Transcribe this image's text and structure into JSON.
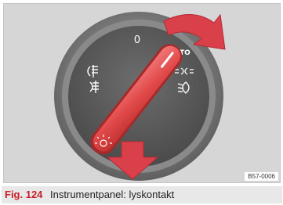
{
  "figure": {
    "label": "Fig. 124",
    "caption": "Instrumentpanel: lyskontakt",
    "image_code": "B57-0006"
  },
  "switch": {
    "pos_off": "0",
    "pos_auto": "AUTO",
    "icon_fog_front": "front-fog-light-icon",
    "icon_fog_rear": "rear-fog-light-icon",
    "icon_parking": "parking-light-icon",
    "icon_low_beam": "low-beam-icon",
    "icon_knob_light": "light-icon"
  },
  "colors": {
    "accent": "#c8202c",
    "knob": "#e24a4a",
    "arrow": "#d9404a",
    "background": "#d6d6d6"
  }
}
